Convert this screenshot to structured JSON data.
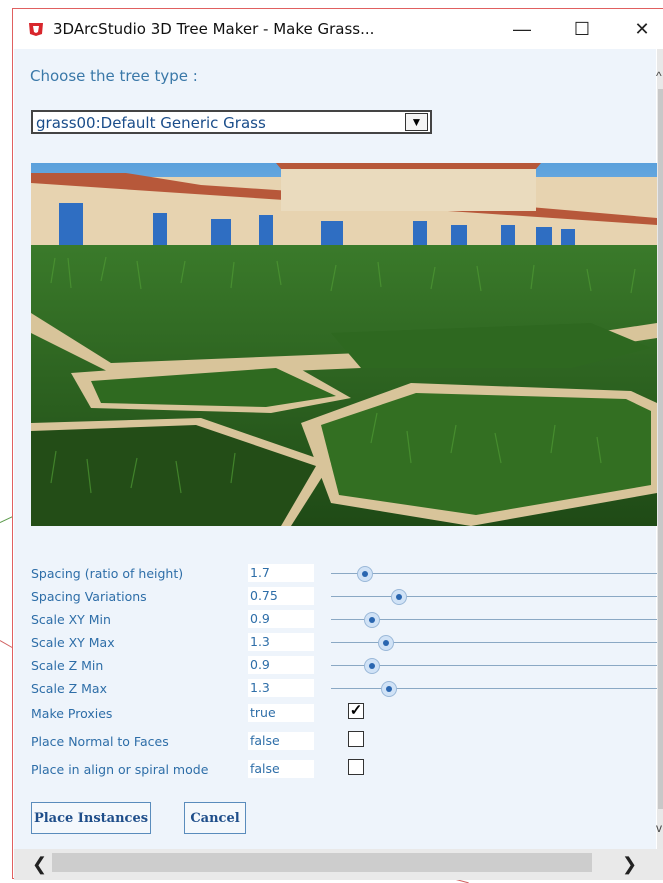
{
  "window": {
    "title": "3DArcStudio 3D Tree Maker - Make Grass...",
    "controls": {
      "minimize": "—",
      "maximize": "☐",
      "close": "✕"
    }
  },
  "tree_type": {
    "label": "Choose the tree type :",
    "selected": "grass00:Default Generic Grass",
    "dropdown_glyph": "▼"
  },
  "preview": {
    "description_icon": "grass-preview-image"
  },
  "params": [
    {
      "label": "Spacing (ratio of height)",
      "value": "1.7",
      "control": "slider",
      "level": 0.1
    },
    {
      "label": "Spacing Variations",
      "value": "0.75",
      "control": "slider",
      "level": 0.2
    },
    {
      "label": "Scale XY Min",
      "value": "0.9",
      "control": "slider",
      "level": 0.12
    },
    {
      "label": "Scale XY Max",
      "value": "1.3",
      "control": "slider",
      "level": 0.16
    },
    {
      "label": "Scale Z Min",
      "value": "0.9",
      "control": "slider",
      "level": 0.12
    },
    {
      "label": "Scale Z Max",
      "value": "1.3",
      "control": "slider",
      "level": 0.17
    },
    {
      "label": "Make Proxies",
      "value": "true",
      "control": "checkbox",
      "checked": true
    },
    {
      "label": "Place Normal to Faces",
      "value": "false",
      "control": "checkbox",
      "checked": false
    },
    {
      "label": "Place in align or spiral mode",
      "value": "false",
      "control": "checkbox",
      "checked": false
    }
  ],
  "buttons": {
    "place": "Place Instances",
    "cancel": "Cancel"
  },
  "scrollbar": {
    "left_glyph": "❮",
    "right_glyph": "❯"
  },
  "colors": {
    "accent": "#2e6ea8",
    "panel_bg": "#eef4fb",
    "border": "#e06060"
  }
}
